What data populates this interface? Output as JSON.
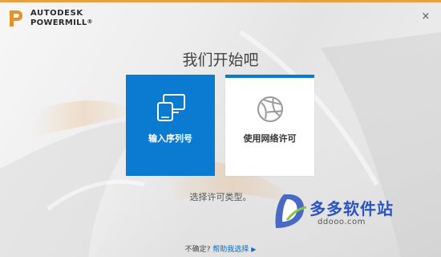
{
  "app": {
    "brand_line1": "AUTODESK",
    "brand_line2": "POWERMILL",
    "brand_suffix": "®",
    "close_glyph": "×"
  },
  "main": {
    "heading": "我们开始吧",
    "cards": [
      {
        "label": "输入序列号",
        "icon": "devices-icon",
        "selected": true
      },
      {
        "label": "使用网络许可",
        "icon": "network-globe-icon",
        "selected": false
      }
    ],
    "hint": "选择许可类型。"
  },
  "footer": {
    "question": "不确定?",
    "help_link": "帮助我选择"
  },
  "watermark": {
    "text": "多多软件站",
    "url": "ddooo.com"
  },
  "colors": {
    "accent": "#0a7bd1",
    "top_line": "#e8a040",
    "watermark": "#2d55c0"
  }
}
